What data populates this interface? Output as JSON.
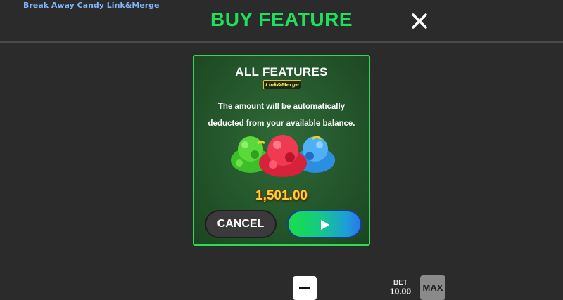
{
  "app": {
    "title": "Break Away Candy Link&Merge"
  },
  "header": {
    "title": "BUY FEATURE",
    "close_icon": "close-icon"
  },
  "panel": {
    "title": "ALL FEATURES",
    "badge": "Link&Merge",
    "description_line1": "The amount will be automatically",
    "description_line2": "deducted from your available balance.",
    "price": "1,501.00",
    "cancel_label": "CANCEL",
    "confirm_icon": "play-icon"
  },
  "footer": {
    "minus_icon": "minus-icon",
    "bet_label": "BET",
    "bet_value": "10.00",
    "max_label": "MAX"
  },
  "colors": {
    "background": "#2b2b2b",
    "title_green": "#1ee05a",
    "panel_border": "#2ddc54",
    "price_gold": "#ffcf3a"
  }
}
